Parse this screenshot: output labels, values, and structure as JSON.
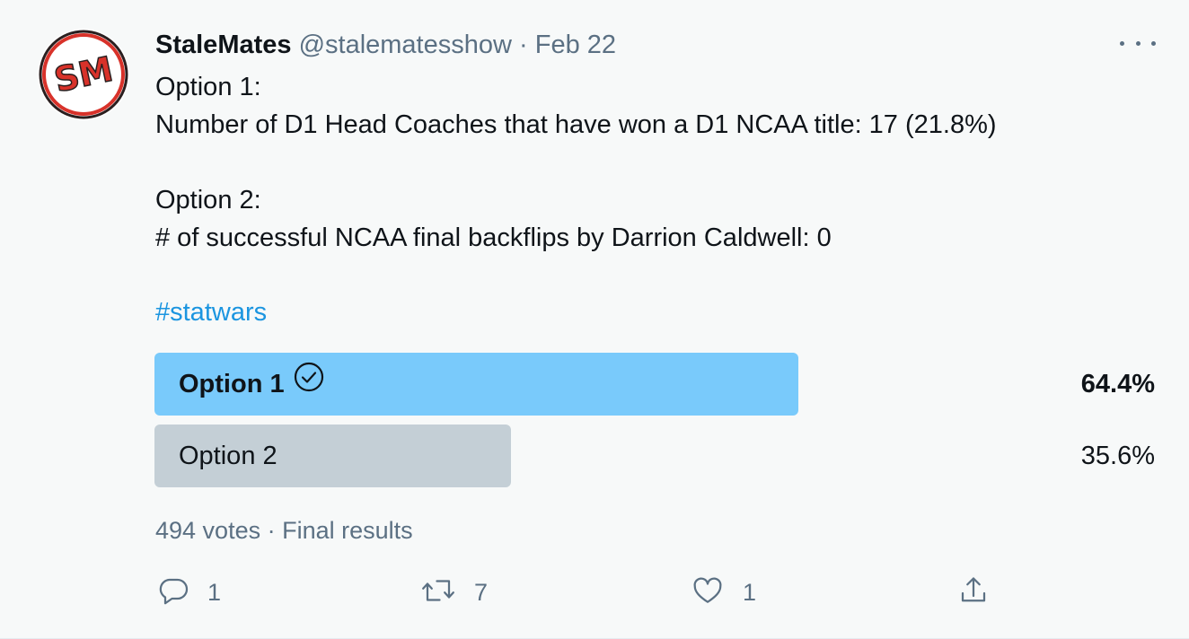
{
  "tweet": {
    "display_name": "StaleMates",
    "handle": "@stalematesshow",
    "separator": "·",
    "date": "Feb 22",
    "avatar_initials": "SM",
    "body_lines": [
      "Option 1:",
      "Number of D1 Head Coaches that have won a D1 NCAA title: 17 (21.8%)",
      "",
      "Option 2:",
      "# of successful NCAA final backflips by Darrion Caldwell: 0"
    ],
    "hashtag": "#statwars"
  },
  "poll": {
    "options": [
      {
        "label": "Option 1",
        "percent_text": "64.4%",
        "percent": 64.4,
        "winner": true
      },
      {
        "label": "Option 2",
        "percent_text": "35.6%",
        "percent": 35.6,
        "winner": false
      }
    ],
    "votes": "494 votes",
    "separator": "·",
    "status": "Final results"
  },
  "actions": {
    "reply_count": "1",
    "retweet_count": "7",
    "like_count": "1"
  },
  "colors": {
    "winner_bar": "#79cafb",
    "loser_bar": "#c4cfd6",
    "hashtag": "#1b95e0",
    "secondary_text": "#5b7083",
    "avatar_red": "#d8322a"
  },
  "icons": {
    "more": "more-horizontal-icon",
    "winner_check": "check-circle-icon",
    "reply": "reply-icon",
    "retweet": "retweet-icon",
    "like": "heart-icon",
    "share": "share-icon"
  }
}
